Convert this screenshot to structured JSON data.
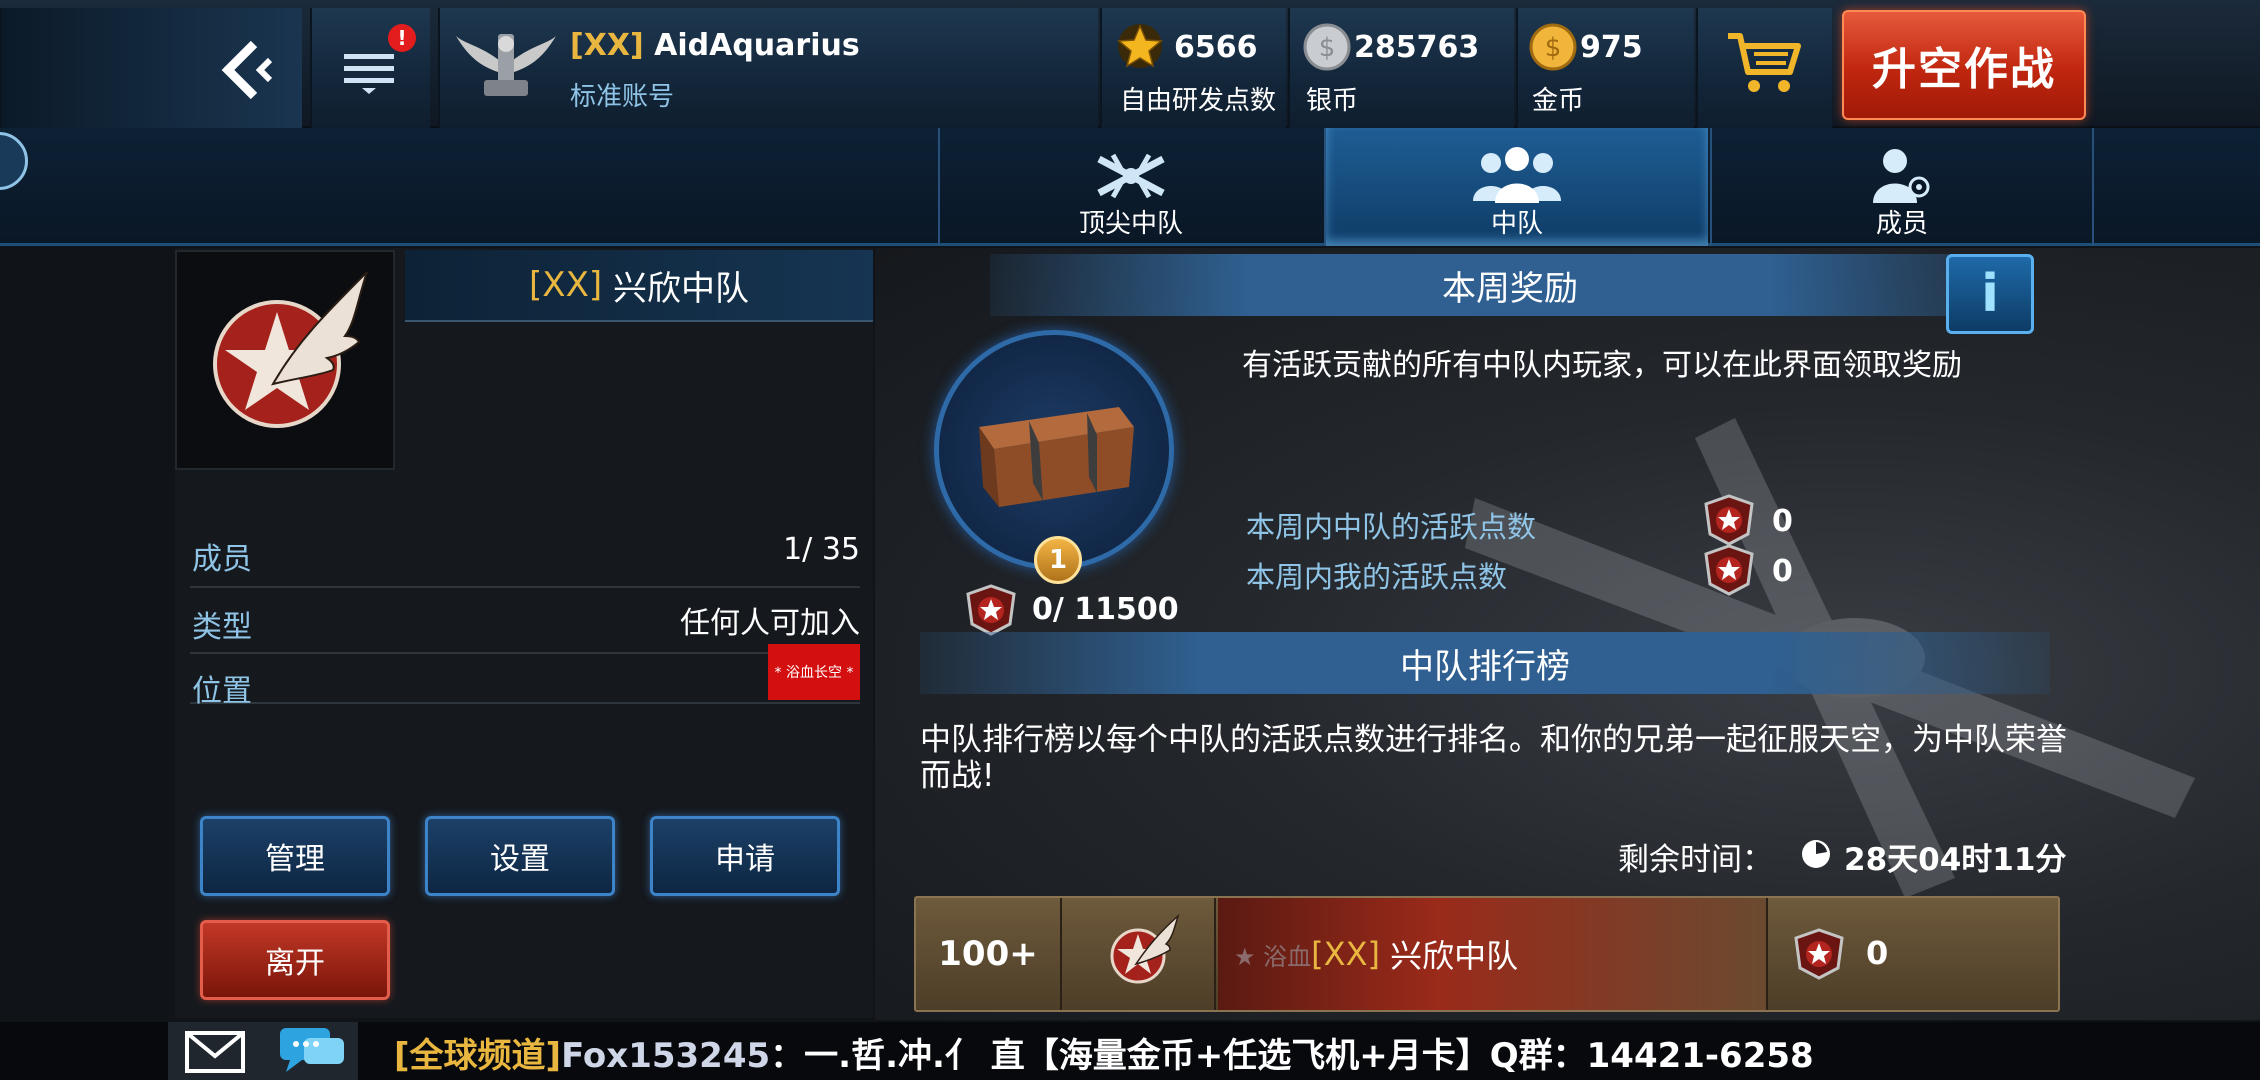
{
  "header": {
    "player_tag": "[XX]",
    "player_name": "AidAquarius",
    "account_type": "标准账号",
    "currencies": [
      {
        "icon": "star-icon",
        "value": "6566",
        "label": "自由研发点数"
      },
      {
        "icon": "silver-coin-icon",
        "value": "285763",
        "label": "银币"
      },
      {
        "icon": "gold-coin-icon",
        "value": "975",
        "label": "金币"
      }
    ],
    "takeoff_label": "升空作战",
    "notification_badge": "!"
  },
  "tabs": [
    {
      "label": "顶尖中队",
      "icon": "planes-icon"
    },
    {
      "label": "中队",
      "icon": "group-icon",
      "active": true
    },
    {
      "label": "成员",
      "icon": "member-icon"
    }
  ],
  "squadron": {
    "tag": "[XX]",
    "name": "兴欣中队",
    "rows": [
      {
        "label": "成员",
        "value": "1/ 35"
      },
      {
        "label": "类型",
        "value": "任何人可加入"
      },
      {
        "label": "位置",
        "value": "",
        "badge": "* 浴血长空 *"
      }
    ],
    "buttons": {
      "manage": "管理",
      "settings": "设置",
      "apply": "申请",
      "leave": "离开"
    }
  },
  "weekly_reward": {
    "title": "本周奖励",
    "description": "有活跃贡献的所有中队内玩家，可以在此界面领取奖励",
    "box_level": "1",
    "box_progress": "0/ 11500",
    "squad_points_label": "本周内中队的活跃点数",
    "squad_points_value": "0",
    "my_points_label": "本周内我的活跃点数",
    "my_points_value": "0",
    "info_label": "i"
  },
  "ranking": {
    "title": "中队排行榜",
    "description": "中队排行榜以每个中队的活跃点数进行排名。和你的兄弟一起征服天空，为中队荣誉而战!",
    "remaining_label": "剩余时间：",
    "remaining_value": "28天04时11分",
    "entry": {
      "rank": "100+",
      "prefix": "★ 浴血",
      "tag": "[XX]",
      "name": "兴欣中队",
      "points": "0"
    }
  },
  "chat": {
    "channel": "[全球频道]",
    "sender": "Fox153245",
    "message": "：一.哲.冲.亻 直【海量金币+任选飞机+月卡】Q群：14421-6258"
  },
  "colors": {
    "gold": "#e9b640",
    "accent_blue": "#2f6091",
    "takeoff_red": "#c0260f"
  }
}
